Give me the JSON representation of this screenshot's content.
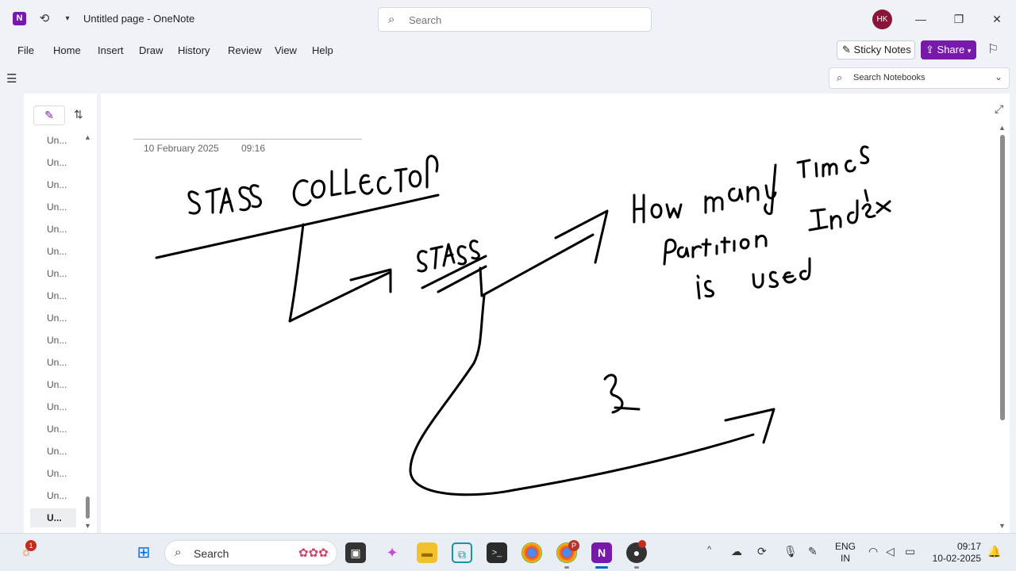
{
  "window": {
    "title": "Untitled page  -  OneNote",
    "search_placeholder": "Search",
    "user_initials": "HK"
  },
  "menu": {
    "items": [
      "File",
      "Home",
      "Insert",
      "Draw",
      "History",
      "Review",
      "View",
      "Help"
    ],
    "sticky_notes": "Sticky Notes",
    "share": "Share"
  },
  "notebook_search": {
    "placeholder": "Search Notebooks"
  },
  "page_list": {
    "items": [
      "Un...",
      "Un...",
      "Un...",
      "Un...",
      "Un...",
      "Un...",
      "Un...",
      "Un...",
      "Un...",
      "Un...",
      "Un...",
      "Un...",
      "Un...",
      "Un...",
      "Un...",
      "Un...",
      "Un...",
      "U..."
    ],
    "active_index": 17
  },
  "page": {
    "date": "10 February 2025",
    "time": "09:16",
    "ink_text": [
      "STATS COLLECTION",
      "STATS",
      "How many times",
      "Partition Index",
      "is used",
      "3"
    ]
  },
  "taskbar": {
    "search_label": "Search",
    "widgets_badge": "1",
    "chrome_profile_badge": "P",
    "language_line1": "ENG",
    "language_line2": "IN",
    "clock_time": "09:17",
    "clock_date": "10-02-2025"
  },
  "colors": {
    "accent": "#7719aa",
    "taskbar_active": "#0067c0",
    "avatar": "#8a1538"
  }
}
